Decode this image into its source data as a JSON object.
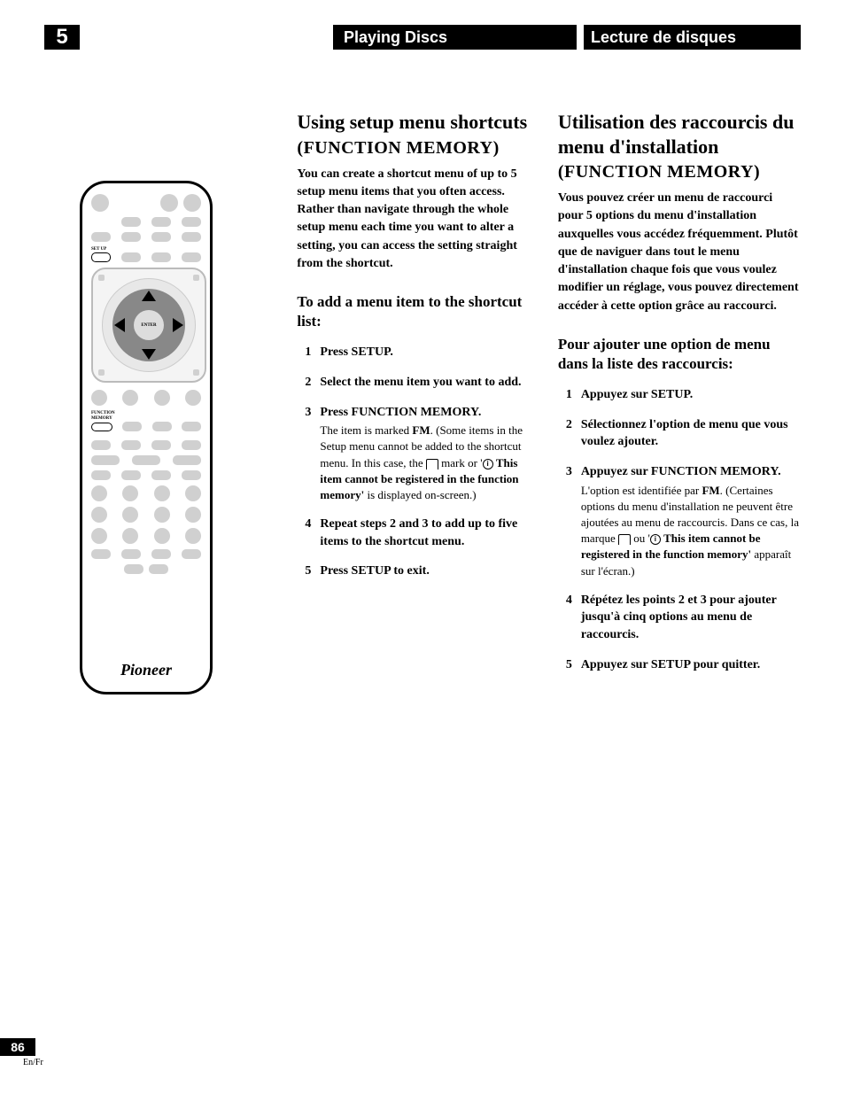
{
  "header": {
    "chapter": "5",
    "title_en": "Playing Discs",
    "title_fr": "Lecture de disques"
  },
  "remote": {
    "setup_label": "SET UP",
    "enter_label": "ENTER",
    "function_memory_label_l1": "FUNCTION",
    "function_memory_label_l2": "MEMORY",
    "brand": "Pioneer"
  },
  "english": {
    "heading": "Using setup menu shortcuts",
    "subhead": "(FUNCTION MEMORY)",
    "intro": "You can create a shortcut menu of up to 5 setup menu items that you often access. Rather than navigate through the whole setup menu each time you want to alter a setting, you can access the setting straight from the shortcut.",
    "h3": "To add a menu item to the shortcut list:",
    "steps": [
      {
        "n": "1",
        "title": "Press SETUP.",
        "detail": ""
      },
      {
        "n": "2",
        "title": "Select the menu item you want to add.",
        "detail": ""
      },
      {
        "n": "3",
        "title": "Press FUNCTION MEMORY.",
        "detail_pre": "The item is marked ",
        "detail_bold": "FM",
        "detail_post": ". (Some items in the Setup menu cannot be added to the shortcut menu. In this case, the ",
        "detail_mark": " mark or '",
        "detail_warn": "This item cannot be registered in the function memory'",
        "detail_end": " is displayed on-screen.)"
      },
      {
        "n": "4",
        "title": "Repeat steps 2 and 3 to add up to five items to the shortcut menu.",
        "detail": ""
      },
      {
        "n": "5",
        "title": "Press SETUP to exit.",
        "detail": ""
      }
    ]
  },
  "french": {
    "heading": "Utilisation des raccourcis du menu d'installation",
    "subhead": "(FUNCTION MEMORY)",
    "intro": "Vous pouvez créer un menu de raccourci pour 5 options du menu d'installation auxquelles vous accédez fréquemment. Plutôt que de naviguer dans tout le menu d'installation chaque fois que vous voulez modifier un réglage, vous pouvez directement accéder à cette option grâce au raccourci.",
    "h3": "Pour ajouter une option de menu dans la liste des raccourcis:",
    "steps": [
      {
        "n": "1",
        "title": "Appuyez sur SETUP.",
        "detail": ""
      },
      {
        "n": "2",
        "title": "Sélectionnez l'option de menu que vous voulez ajouter.",
        "detail": ""
      },
      {
        "n": "3",
        "title": "Appuyez sur FUNCTION MEMORY.",
        "detail_pre": "L'option est identifiée par ",
        "detail_bold": "FM",
        "detail_post": ". (Certaines options du menu d'installation ne peuvent être ajoutées au menu de raccourcis.  Dans ce cas, la marque ",
        "detail_mark": " ou '",
        "detail_warn": "This item cannot be registered in the function memory'",
        "detail_end": " apparaît sur l'écran.)"
      },
      {
        "n": "4",
        "title": "Répétez les points 2 et 3 pour ajouter jusqu'à cinq options au menu de raccourcis.",
        "detail": ""
      },
      {
        "n": "5",
        "title": "Appuyez sur SETUP pour quitter.",
        "detail": ""
      }
    ]
  },
  "footer": {
    "page": "86",
    "lang": "En/Fr"
  }
}
